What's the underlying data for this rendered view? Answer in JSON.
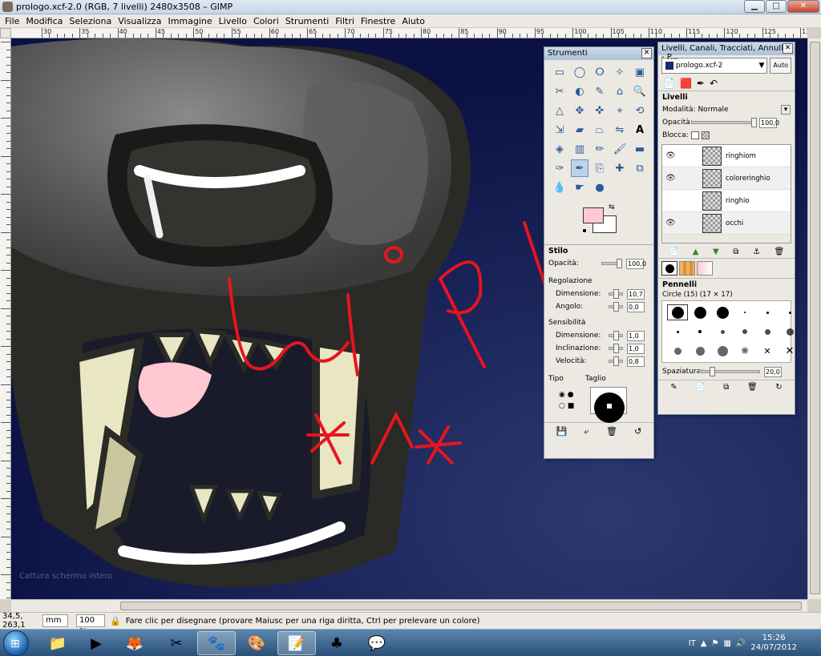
{
  "window": {
    "title": "prologo.xcf-2.0 (RGB, 7 livelli) 2480x3508 – GIMP",
    "btn_min": "▁",
    "btn_max": "□",
    "btn_close": "✕"
  },
  "menu": [
    "File",
    "Modifica",
    "Seleziona",
    "Visualizza",
    "Immagine",
    "Livello",
    "Colori",
    "Strumenti",
    "Filtri",
    "Finestre",
    "Aiuto"
  ],
  "ruler": {
    "labels": [
      "30",
      "35",
      "40",
      "45",
      "50",
      "55",
      "60",
      "65",
      "70",
      "75",
      "80",
      "85",
      "90",
      "95",
      "100",
      "105",
      "110",
      "115",
      "120",
      "125",
      "130"
    ]
  },
  "canvas": {
    "scribbles": "u l p l",
    "faint_text": "Cattura schermo intero"
  },
  "toolbox": {
    "title": "Strumenti",
    "tool_options_title": "Stilo",
    "opacity_label": "Opacità:",
    "opacity_value": "100,0",
    "adjust_label": "Regolazione",
    "size_label": "Dimensione:",
    "size_value": "10,7",
    "angle_label": "Angolo:",
    "angle_value": "0,0",
    "sensitivity_label": "Sensibilità",
    "sens_size_label": "Dimensione:",
    "sens_size_value": "1,0",
    "tilt_label": "Inclinazione:",
    "tilt_value": "1,0",
    "speed_label": "Velocità:",
    "speed_value": "0,8",
    "type_label": "Tipo",
    "shape_label": "Taglio"
  },
  "layers_dock": {
    "title": "Livelli, Canali, Tracciati, Annulla - P...",
    "image_name": "prologo.xcf-2",
    "auto_label": "Auto",
    "section": "Livelli",
    "mode_label": "Modalità:",
    "mode_value": "Normale",
    "opacity_label": "Opacità:",
    "opacity_value": "100,0",
    "lock_label": "Blocca:",
    "layers": [
      {
        "name": "ringhiom",
        "visible": true
      },
      {
        "name": "coloreringhio",
        "visible": true
      },
      {
        "name": "ringhio",
        "visible": false
      },
      {
        "name": "occhi",
        "visible": true
      }
    ],
    "brushes_title": "Pennelli",
    "brush_info": "Circle (15) (17 × 17)",
    "spacing_label": "Spaziatura:",
    "spacing_value": "20,0"
  },
  "status": {
    "coords": "34,5, 263,1",
    "unit": "mm",
    "zoom": "100 %",
    "message": "Fare clic per disegnare (provare Maiusc per una riga diritta, Ctrl per prelevare un colore)"
  },
  "taskbar": {
    "lang": "IT",
    "time": "15:26",
    "date": "24/07/2012"
  },
  "colors": {
    "fg": "#000000",
    "bg": "#ffffff",
    "pink": "#ffc8d2",
    "canvas_bg": "#0d1446",
    "scribble": "#e8141e"
  }
}
